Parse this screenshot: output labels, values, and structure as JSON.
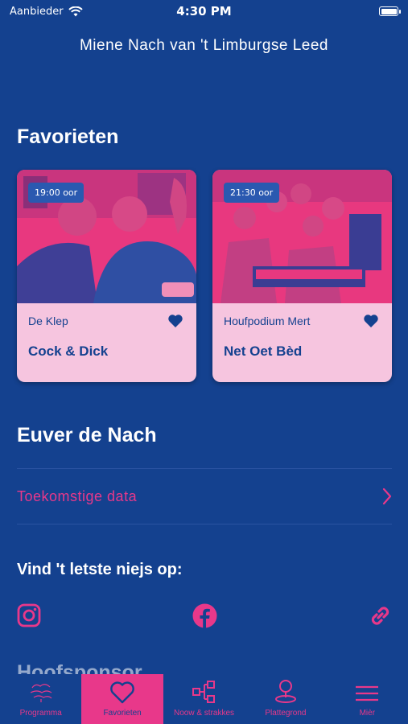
{
  "status_bar": {
    "carrier": "Aanbieder",
    "time": "4:30 PM"
  },
  "header": {
    "title": "Miene Nach van 't Limburgse Leed"
  },
  "favorites": {
    "title": "Favorieten",
    "cards": [
      {
        "time": "19:00 oor",
        "venue": "De Klep",
        "name": "Cock & Dick"
      },
      {
        "time": "21:30 oor",
        "venue": "Houfpodium Mert",
        "name": "Net Oet Bèd"
      }
    ]
  },
  "about": {
    "title": "Euver de Nach",
    "link_label": "Toekomstige data"
  },
  "social": {
    "title": "Vind 't letste niejs op:",
    "icons": [
      "instagram-icon",
      "facebook-icon",
      "link-icon"
    ]
  },
  "next_section": {
    "title": "Hoofsponsor"
  },
  "tabbar": {
    "tabs": [
      {
        "label": "Programma",
        "icon": "logo-icon"
      },
      {
        "label": "Favorieten",
        "icon": "heart-icon"
      },
      {
        "label": "Noow & strakkes",
        "icon": "schedule-icon"
      },
      {
        "label": "Plattegrond",
        "icon": "map-pin-icon"
      },
      {
        "label": "Mièr",
        "icon": "menu-icon"
      }
    ],
    "active": "Favorieten"
  },
  "colors": {
    "background": "#14418f",
    "accent": "#e8388a",
    "card": "#f6c5df"
  }
}
